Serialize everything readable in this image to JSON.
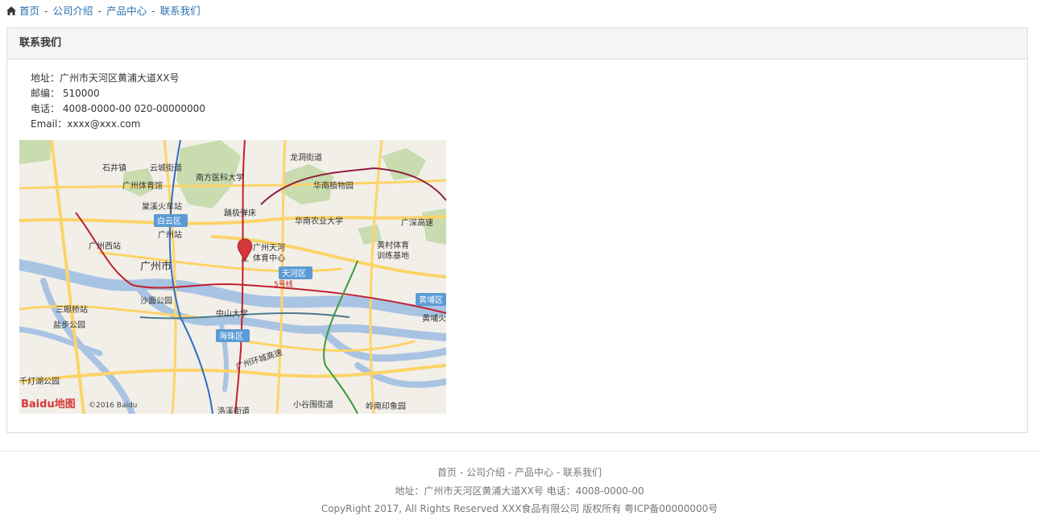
{
  "breadcrumb": {
    "items": [
      "首页",
      "公司介绍",
      "产品中心",
      "联系我们"
    ],
    "separator": "-"
  },
  "panel": {
    "title": "联系我们"
  },
  "contact": {
    "address": "地址：广州市天河区黄浦大道XX号",
    "postcode": "邮编： 510000",
    "phone": "电话： 4008-0000-00 020-00000000",
    "email": "Email：xxxx@xxx.com"
  },
  "map": {
    "labels": {
      "shijingzhen": "石井镇",
      "yunchengjiedao": "云城街道",
      "longdongjiedao": "龙洞街道",
      "nanfangyike": "南方医科大学",
      "guangzhoutiyuguan": "广州体育馆",
      "huananzhiwuyuan": "华南植物园",
      "chaixihuochezhan": "棠溪火车站",
      "yanjidanchang": "踊极弹床",
      "baiyunqu": "白云区",
      "huanannongye": "华南农业大学",
      "guangshengaosu": "广深高速",
      "guangzhouzhan": "广州站",
      "guangzhouxizhan": "广州西站",
      "guangzhoutianhe": "广州天河",
      "tiyuzhongxin": "体育中心",
      "huangcun": "黄村体育",
      "xunlianjidi": "训练基地",
      "guangzhoushi": "广州市",
      "tianhequ": "天河区",
      "line5": "5号线",
      "shamiangongyuan": "沙面公园",
      "huangpuqu": "黄埔区",
      "sanyanqiaozhan": "三眼桥站",
      "zhongshandaxue": "中山大学",
      "huangpuhuo": "黄埔火",
      "yanbugongyuan": "盐步公园",
      "haizhuqu": "海珠区",
      "huanchenggaosu": "广州环城高速",
      "qianhuideng": "千灯湖公园",
      "xiaoguwei": "小谷围街道",
      "lingnanyinxiang": "岭南印象园",
      "luojiao": "洛溪街道",
      "copyright": "©2016 Baidu",
      "logo": "Baidu地图"
    }
  },
  "footer": {
    "links": [
      "首页",
      "公司介绍",
      "产品中心",
      "联系我们"
    ],
    "link_separator": " - ",
    "address_line": "地址：广州市天河区黄浦大道XX号 电话：4008-0000-00",
    "copyright": "CopyRight 2017, All Rights Reserved XXX食品有限公司 版权所有 粤ICP备00000000号"
  },
  "colors": {
    "link": "#2a6fb0",
    "map_bg": "#f2efe9",
    "water": "#a9c3e3",
    "road": "#fcd468",
    "park": "#c8dcb0",
    "metro_red": "#c0202e",
    "marker": "#d6373a"
  }
}
